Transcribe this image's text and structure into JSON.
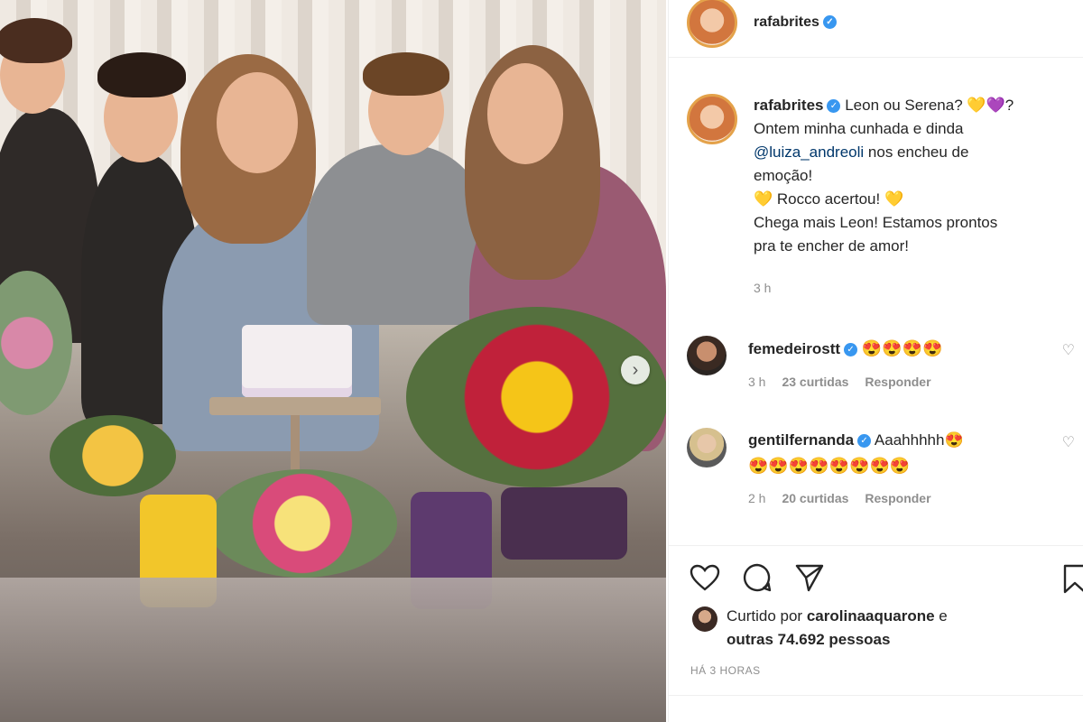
{
  "post": {
    "username": "rafabrites",
    "caption_lines": [
      "Leon ou Serena? 💛💜?",
      "Ontem minha cunhada e dinda",
      "@luiza_andreoli",
      "nos encheu de",
      "emoção!",
      "💛 Rocco acertou! 💛",
      "Chega mais Leon! Estamos prontos",
      "pra te encher de amor!"
    ],
    "caption_time": "3 h"
  },
  "comments": [
    {
      "username": "femedeirostt",
      "text": "😍😍😍😍",
      "text2": "",
      "time": "3 h",
      "likes": "23 curtidas",
      "reply": "Responder"
    },
    {
      "username": "gentilfernanda",
      "text": "Aaahhhhh😍",
      "text2": "😍😍😍😍😍😍😍😍",
      "time": "2 h",
      "likes": "20 curtidas",
      "reply": "Responder"
    }
  ],
  "likes": {
    "prefix": "Curtido por",
    "user": "carolinaaquarone",
    "conj": "e",
    "others": "outras 74.692 pessoas"
  },
  "posted": "HÁ 3 HORAS",
  "icons": {
    "verified": "✓",
    "heart_small": "♡",
    "next": "›"
  }
}
